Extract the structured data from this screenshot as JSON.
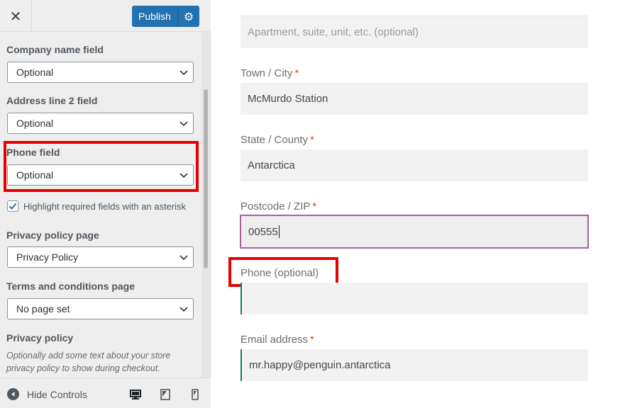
{
  "topbar": {
    "close_icon": "close-icon",
    "publish_label": "Publish",
    "settings_icon": "gear-icon"
  },
  "sidebar": {
    "fields": [
      {
        "label": "Company name field",
        "value": "Optional"
      },
      {
        "label": "Address line 2 field",
        "value": "Optional"
      },
      {
        "label": "Phone field",
        "value": "Optional"
      }
    ],
    "checkbox": {
      "label": "Highlight required fields with an asterisk",
      "checked": true
    },
    "pages": [
      {
        "label": "Privacy policy page",
        "value": "Privacy Policy"
      },
      {
        "label": "Terms and conditions page",
        "value": "No page set"
      }
    ],
    "privacy_policy": {
      "label": "Privacy policy",
      "description": "Optionally add some text about your store privacy policy to show during checkout."
    }
  },
  "footer": {
    "hide_controls_label": "Hide Controls",
    "devices": [
      "desktop-icon",
      "tablet-icon",
      "mobile-icon"
    ]
  },
  "form": {
    "address2_placeholder": "Apartment, suite, unit, etc. (optional)",
    "town": {
      "label": "Town / City",
      "required": "*",
      "value": "McMurdo Station"
    },
    "state": {
      "label": "State / County",
      "required": "*",
      "value": "Antarctica"
    },
    "postcode": {
      "label": "Postcode / ZIP",
      "required": "*",
      "value": "00555"
    },
    "phone": {
      "label": "Phone (optional)",
      "value": ""
    },
    "email": {
      "label": "Email address",
      "required": "*",
      "value": "mr.happy@penguin.antarctica"
    }
  },
  "colors": {
    "accent": "#2271b1",
    "highlight": "#e60000",
    "required": "#e2401c",
    "focus": "#a46497",
    "valid": "#0f834d"
  }
}
